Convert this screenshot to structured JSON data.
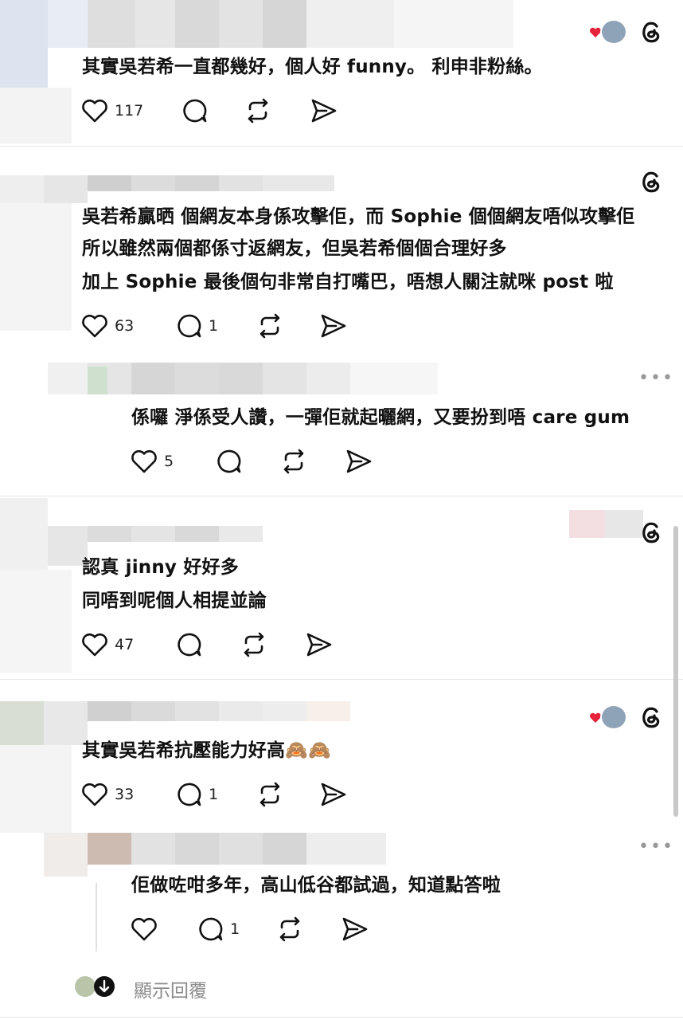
{
  "posts": [
    {
      "lines": [
        "其實吳若希一直都幾好，個人好 funny。 利申非粉絲。"
      ],
      "likes": "117",
      "replies": ""
    },
    {
      "lines": [
        "吳若希贏晒 個網友本身係攻擊佢，而 Sophie 個個網友唔似攻擊佢",
        "所以雖然兩個都係寸返網友，但吳若希個個合理好多",
        "加上 Sophie 最後個句非常自打嘴巴，唔想人關注就咪 post 啦"
      ],
      "likes": "63",
      "replies": "1"
    },
    {
      "lines": [
        "係囉 淨係受人讚，一彈佢就起曬網，又要扮到唔 care gum"
      ],
      "likes": "5",
      "replies": ""
    },
    {
      "lines": [
        "認真 jinny 好好多",
        "同唔到呢個人相提並論"
      ],
      "likes": "47",
      "replies": ""
    },
    {
      "lines": [
        "其實吳若希抗壓能力好高🙈🙈"
      ],
      "likes": "33",
      "replies": "1"
    },
    {
      "lines": [
        "佢做咗咁多年，高山低谷都試過，知道點答啦"
      ],
      "likes": "",
      "replies": "1"
    }
  ],
  "footer": {
    "show_replies_label": "顯示回覆"
  },
  "icons": {
    "like": "heart-outline-icon",
    "reply": "speech-bubble-icon",
    "repost": "repost-icon",
    "share": "send-icon",
    "app": "threads-logo-icon",
    "more": "more-icon"
  },
  "colors": {
    "heart_badge": "#e5243b",
    "muted": "#8a8a8a"
  }
}
